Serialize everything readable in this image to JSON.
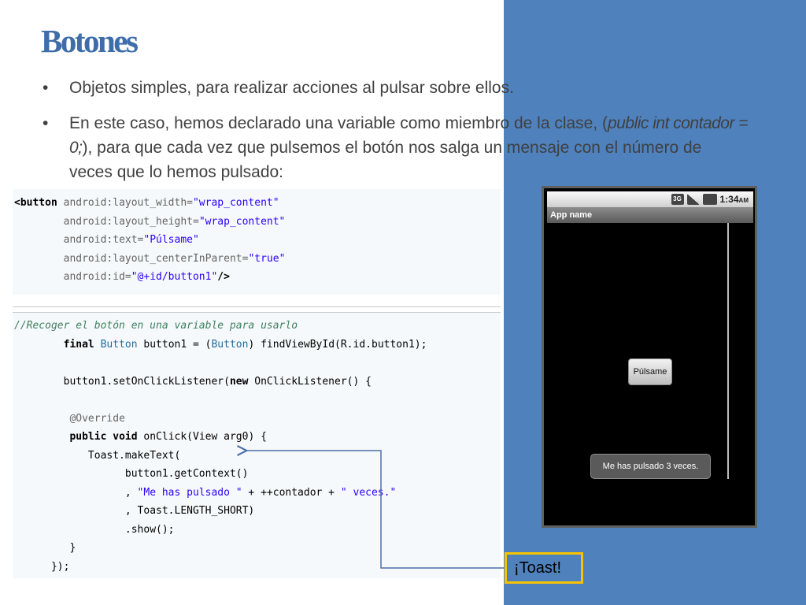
{
  "slide": {
    "title": "Botones",
    "bullets": [
      {
        "text": "Objetos simples, para realizar acciones al pulsar sobre ellos."
      },
      {
        "text_before": "En este caso, hemos declarado una variable como miembro de la clase, (",
        "text_italic": "public int contador = 0;",
        "text_after": "), para que cada vez que pulsemos el botón nos salga un mensaje con el número de veces que lo hemos pulsado:"
      }
    ],
    "callout_label": "¡Toast!"
  },
  "code": {
    "xml": {
      "l1_tag": "<button",
      "l1_attr": " android:layout_width=",
      "l1_val": "\"wrap_content\"",
      "l2_attr": "android:layout_height=",
      "l2_val": "\"wrap_content\"",
      "l3_attr": "android:text=",
      "l3_val": "\"Púlsame\"",
      "l4_attr": "android:layout_centerInParent=",
      "l4_val": "\"true\"",
      "l5_attr": "android:id=",
      "l5_val": "\"@+id/button1\"",
      "l5_end": "/>"
    },
    "java": {
      "comment": "//Recoger el botón en una variable para usarlo",
      "l2_kw": "final",
      "l2_type1": " Button",
      "l2_rest": " button1 = (",
      "l2_type2": "Button",
      "l2_end": ") findViewById(R.id.button1);",
      "l3_a": "button1.setOnClickListener(",
      "l3_kw": "new",
      "l3_b": " OnClickListener() {",
      "l4_ann": "@Override",
      "l5_kw1": "public",
      "l5_kw2": " void",
      "l5_rest": " onClick(View arg0) {",
      "l6": "Toast.makeText(",
      "l7": "button1.getContext()",
      "l8_a": ", ",
      "l8_s1": "\"Me has pulsado \"",
      "l8_b": " + ++contador + ",
      "l8_s2": "\" veces.\"",
      "l9": ", Toast.LENGTH_SHORT)",
      "l10": ".show();",
      "l11": "}",
      "l12": "});"
    }
  },
  "phone": {
    "status_time": "1:34",
    "status_am": "AM",
    "network_badge": "3G",
    "app_name": "App name",
    "button_label": "Púlsame",
    "toast_message": "Me has pulsado 3 veces."
  },
  "colors": {
    "title": "#3e6da9",
    "panel_blue": "#4f81bd",
    "callout_border": "#f4c400",
    "code_string": "#2a00ff",
    "code_comment": "#3f7f5f"
  }
}
